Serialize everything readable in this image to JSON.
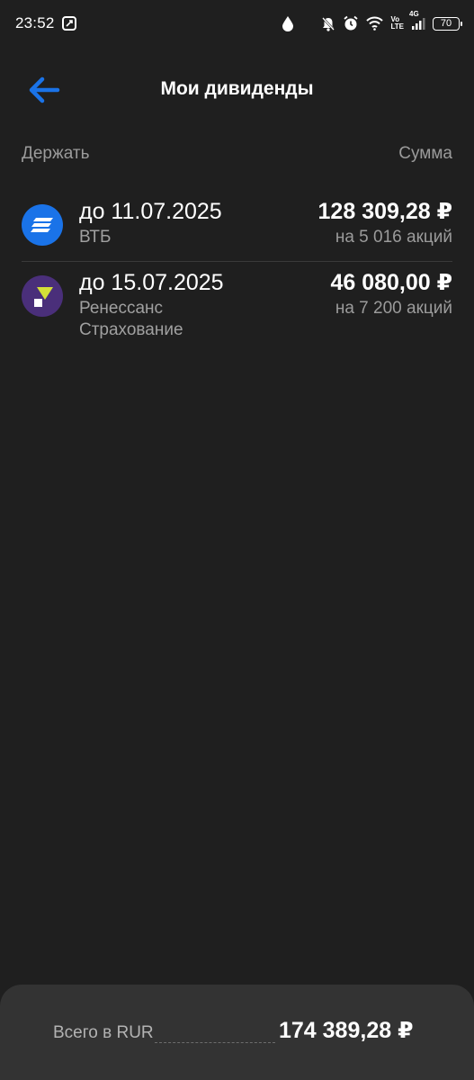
{
  "status_bar": {
    "time": "23:52",
    "network_top": "Vo",
    "network_bottom": "LTE",
    "signal_type": "4G",
    "battery": "70"
  },
  "header": {
    "title": "Мои дивиденды",
    "back_icon": "arrow-left-icon",
    "accent_color": "#1a73e8"
  },
  "columns": {
    "left": "Держать",
    "right": "Сумма"
  },
  "dividends": [
    {
      "date": "до 11.07.2025",
      "company": "ВТБ",
      "amount": "128 309,28 ₽",
      "shares": "на 5 016 акций",
      "logo": "vtb-logo-icon"
    },
    {
      "date": "до 15.07.2025",
      "company": "Ренессанс Страхование",
      "amount": "46 080,00 ₽",
      "shares": "на 7 200 акций",
      "logo": "renaissance-logo-icon"
    }
  ],
  "footer": {
    "total_label": "Всего в RUR",
    "total_value": "174 389,28 ₽"
  }
}
